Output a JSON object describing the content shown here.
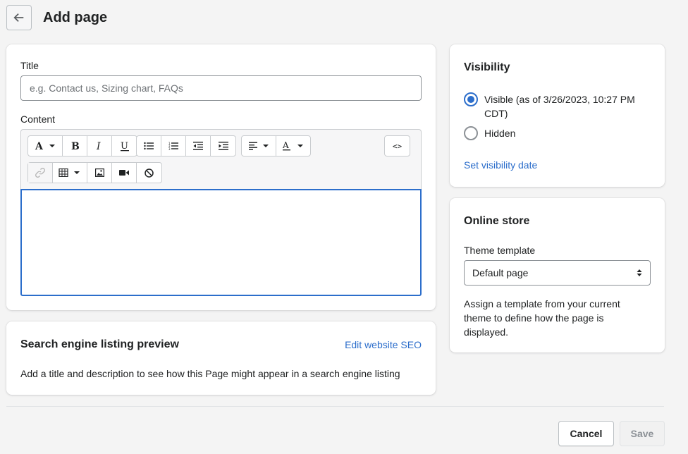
{
  "header": {
    "title": "Add page",
    "back_icon": "arrow-left-icon"
  },
  "main": {
    "title_label": "Title",
    "title_placeholder": "e.g. Contact us, Sizing chart, FAQs",
    "title_value": "",
    "content_label": "Content",
    "toolbar": {
      "code_view_label": "<>",
      "icons": [
        "text-format-icon",
        "bold-icon",
        "italic-icon",
        "underline-icon",
        "bullet-list-icon",
        "numbered-list-icon",
        "outdent-icon",
        "indent-icon",
        "align-icon",
        "text-color-icon",
        "code-view-icon",
        "link-icon",
        "table-icon",
        "image-icon",
        "video-icon",
        "clear-formatting-icon"
      ]
    }
  },
  "seo": {
    "heading": "Search engine listing preview",
    "edit_link": "Edit website SEO",
    "description": "Add a title and description to see how this Page might appear in a search engine listing"
  },
  "visibility": {
    "heading": "Visibility",
    "options": [
      {
        "label": "Visible (as of 3/26/2023, 10:27 PM CDT)",
        "checked": true
      },
      {
        "label": "Hidden",
        "checked": false
      }
    ],
    "set_date_link": "Set visibility date"
  },
  "online_store": {
    "heading": "Online store",
    "theme_template_label": "Theme template",
    "selected_template": "Default page",
    "help_text": "Assign a template from your current theme to define how the page is displayed."
  },
  "footer": {
    "cancel_label": "Cancel",
    "save_label": "Save"
  },
  "colors": {
    "accent": "#2c6ecb",
    "background": "#f4f4f4",
    "disabled_button": "#f1f1f1"
  }
}
